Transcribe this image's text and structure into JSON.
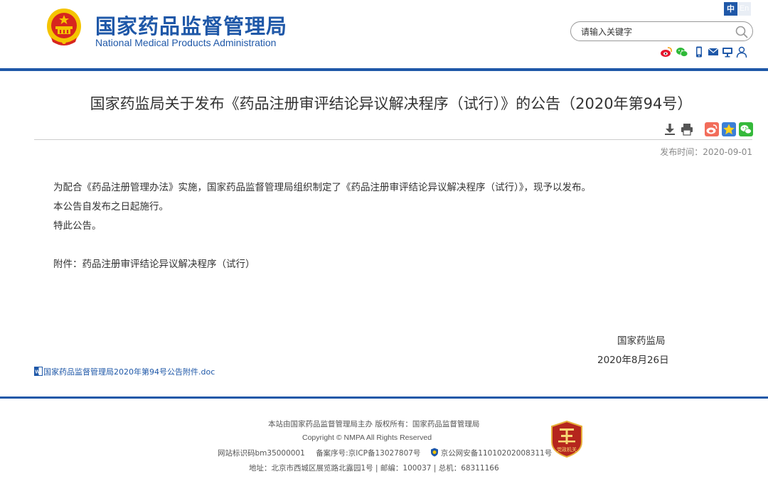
{
  "header": {
    "site_name_cn": "国家药品监督管理局",
    "site_name_en": "National Medical Products Administration",
    "lang_cn": "中",
    "lang_en": "En",
    "search_placeholder": "请输入关键字"
  },
  "social_icons": [
    "weibo-icon",
    "wechat-icon",
    "mobile-icon",
    "mail-icon",
    "monitor-icon",
    "user-icon"
  ],
  "article": {
    "title": "国家药监局关于发布《药品注册审评结论异议解决程序（试行）》的公告（2020年第94号）",
    "publish_time": "发布时间：2020-09-01",
    "paragraphs": [
      "为配合《药品注册管理办法》实施，国家药品监督管理局组织制定了《药品注册审评结论异议解决程序（试行）》，现予以发布。",
      "本公告自发布之日起施行。",
      "特此公告。"
    ],
    "attachment_text": "附件：药品注册审评结论异议解决程序（试行）",
    "signoff_org": "国家药监局",
    "signoff_date": "2020年8月26日",
    "attachment_link": "国家药品监督管理局2020年第94号公告附件.doc"
  },
  "tools": [
    "download-icon",
    "print-icon",
    "weibo-share-icon",
    "qzone-share-icon",
    "wechat-share-icon"
  ],
  "footer": {
    "line1": "本站由国家药品监督管理局主办 版权所有：国家药品监督管理局",
    "line2": "Copyright © NMPA All Rights Reserved",
    "line3_a": "网站标识码bm35000001",
    "line3_b": "备案序号:京ICP备13027807号",
    "line3_c": "京公网安备11010202008311号",
    "line4": "地址：北京市西城区展览路北露园1号 | 邮编：100037 | 总机：68311166",
    "badge_text": "党政机关"
  },
  "colors": {
    "brand_blue": "#1f58a8",
    "emblem_red": "#d7261e",
    "emblem_gold": "#f5c400",
    "badge_red": "#b5261d"
  }
}
